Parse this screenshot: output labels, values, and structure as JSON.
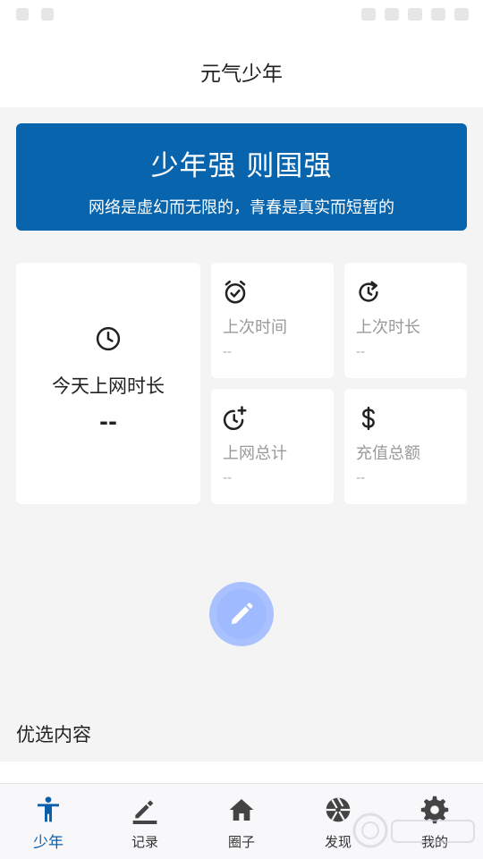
{
  "app": {
    "title": "元气少年"
  },
  "banner": {
    "headline": "少年强 则国强",
    "subtitle": "网络是虚幻而无限的，青春是真实而短暂的"
  },
  "stats": {
    "today": {
      "label": "今天上网时长",
      "value": "--",
      "icon": "clock-icon"
    },
    "last_time": {
      "label": "上次时间",
      "value": "--",
      "icon": "alarm-icon"
    },
    "last_duration": {
      "label": "上次时长",
      "value": "--",
      "icon": "history-icon"
    },
    "total_online": {
      "label": "上网总计",
      "value": "--",
      "icon": "clock-plus-icon"
    },
    "recharge_total": {
      "label": "充值总额",
      "value": "--",
      "icon": "dollar-icon"
    }
  },
  "fab": {
    "icon": "pencil-icon"
  },
  "section": {
    "title": "优选内容"
  },
  "nav": {
    "items": [
      {
        "label": "少年",
        "icon": "person-icon",
        "active": true
      },
      {
        "label": "记录",
        "icon": "edit-icon"
      },
      {
        "label": "圈子",
        "icon": "home-icon"
      },
      {
        "label": "发现",
        "icon": "aperture-icon"
      },
      {
        "label": "我的",
        "icon": "gear-icon"
      }
    ]
  },
  "colors": {
    "primary": "#0865ad",
    "fab": "#a9c2ff",
    "nav_active": "#0b5fa8",
    "muted": "#9a9a9a"
  }
}
